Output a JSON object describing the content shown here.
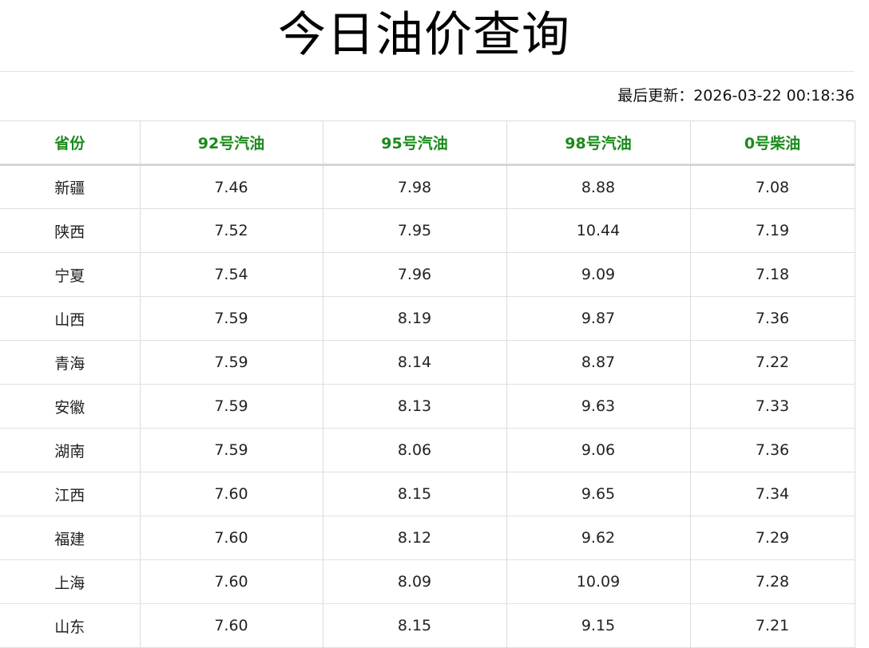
{
  "page": {
    "title": "今日油价查询",
    "update_label": "最后更新：",
    "update_time": "2026-03-22 00:18:36"
  },
  "table": {
    "headers": [
      "省份",
      "92号汽油",
      "95号汽油",
      "98号汽油",
      "0号柴油"
    ],
    "rows": [
      [
        "新疆",
        "7.46",
        "7.98",
        "8.88",
        "7.08"
      ],
      [
        "陕西",
        "7.52",
        "7.95",
        "10.44",
        "7.19"
      ],
      [
        "宁夏",
        "7.54",
        "7.96",
        "9.09",
        "7.18"
      ],
      [
        "山西",
        "7.59",
        "8.19",
        "9.87",
        "7.36"
      ],
      [
        "青海",
        "7.59",
        "8.14",
        "8.87",
        "7.22"
      ],
      [
        "安徽",
        "7.59",
        "8.13",
        "9.63",
        "7.33"
      ],
      [
        "湖南",
        "7.59",
        "8.06",
        "9.06",
        "7.36"
      ],
      [
        "江西",
        "7.60",
        "8.15",
        "9.65",
        "7.34"
      ],
      [
        "福建",
        "7.60",
        "8.12",
        "9.62",
        "7.29"
      ],
      [
        "上海",
        "7.60",
        "8.09",
        "10.09",
        "7.28"
      ],
      [
        "山东",
        "7.60",
        "8.15",
        "9.15",
        "7.21"
      ]
    ]
  },
  "colors": {
    "header_text": "#1a8a1a",
    "border": "#dcdcdc"
  }
}
